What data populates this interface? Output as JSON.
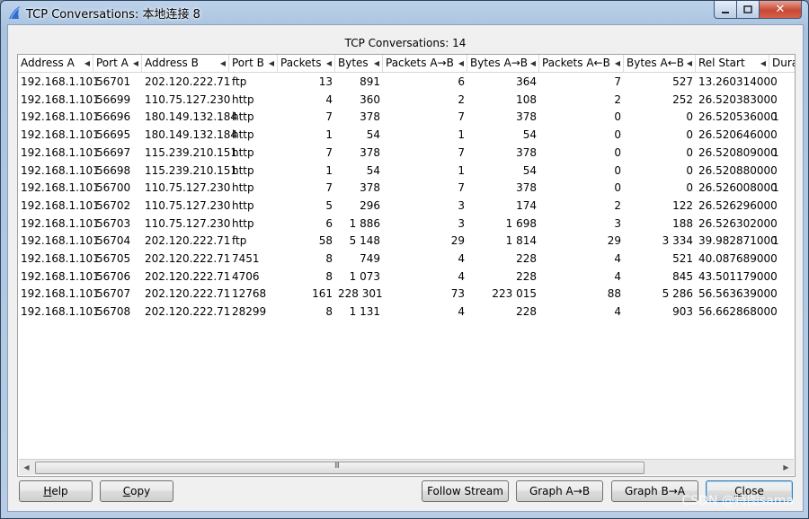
{
  "window": {
    "title": "TCP Conversations: 本地连接 8",
    "minimize_icon": "minimize-icon",
    "maximize_icon": "maximize-icon",
    "close_symbol": "✕"
  },
  "table": {
    "caption": "TCP Conversations: 14",
    "columns": [
      "Address A",
      "Port A",
      "Address B",
      "Port B",
      "Packets",
      "Bytes",
      "Packets A→B",
      "Bytes A→B",
      "Packets A←B",
      "Bytes A←B",
      "Rel Start",
      "Dura"
    ],
    "rows": [
      [
        "192.168.1.101",
        "56701",
        "202.120.222.71",
        "ftp",
        "13",
        "891",
        "6",
        "364",
        "7",
        "527",
        "13.260314000",
        ""
      ],
      [
        "192.168.1.101",
        "56699",
        "110.75.127.230",
        "http",
        "4",
        "360",
        "2",
        "108",
        "2",
        "252",
        "26.520383000",
        ""
      ],
      [
        "192.168.1.101",
        "56696",
        "180.149.132.184",
        "http",
        "7",
        "378",
        "7",
        "378",
        "0",
        "0",
        "26.520536000",
        "1"
      ],
      [
        "192.168.1.101",
        "56695",
        "180.149.132.184",
        "http",
        "1",
        "54",
        "1",
        "54",
        "0",
        "0",
        "26.520646000",
        ""
      ],
      [
        "192.168.1.101",
        "56697",
        "115.239.210.151",
        "http",
        "7",
        "378",
        "7",
        "378",
        "0",
        "0",
        "26.520809000",
        "1"
      ],
      [
        "192.168.1.101",
        "56698",
        "115.239.210.151",
        "http",
        "1",
        "54",
        "1",
        "54",
        "0",
        "0",
        "26.520880000",
        ""
      ],
      [
        "192.168.1.101",
        "56700",
        "110.75.127.230",
        "http",
        "7",
        "378",
        "7",
        "378",
        "0",
        "0",
        "26.526008000",
        "1"
      ],
      [
        "192.168.1.101",
        "56702",
        "110.75.127.230",
        "http",
        "5",
        "296",
        "3",
        "174",
        "2",
        "122",
        "26.526296000",
        ""
      ],
      [
        "192.168.1.101",
        "56703",
        "110.75.127.230",
        "http",
        "6",
        "1 886",
        "3",
        "1 698",
        "3",
        "188",
        "26.526302000",
        ""
      ],
      [
        "192.168.1.101",
        "56704",
        "202.120.222.71",
        "ftp",
        "58",
        "5 148",
        "29",
        "1 814",
        "29",
        "3 334",
        "39.982871000",
        "1"
      ],
      [
        "192.168.1.101",
        "56705",
        "202.120.222.71",
        "7451",
        "8",
        "749",
        "4",
        "228",
        "4",
        "521",
        "40.087689000",
        ""
      ],
      [
        "192.168.1.101",
        "56706",
        "202.120.222.71",
        "4706",
        "8",
        "1 073",
        "4",
        "228",
        "4",
        "845",
        "43.501179000",
        ""
      ],
      [
        "192.168.1.101",
        "56707",
        "202.120.222.71",
        "12768",
        "161",
        "228 301",
        "73",
        "223 015",
        "88",
        "5 286",
        "56.563639000",
        ""
      ],
      [
        "192.168.1.101",
        "56708",
        "202.120.222.71",
        "28299",
        "8",
        "1 131",
        "4",
        "228",
        "4",
        "903",
        "56.662868000",
        ""
      ]
    ]
  },
  "scrollbar": {
    "left_arrow": "◀",
    "right_arrow": "▶",
    "grip": "III"
  },
  "buttons": {
    "help": {
      "u": "H",
      "rest": "elp"
    },
    "copy": {
      "u": "C",
      "rest": "opy"
    },
    "follow_stream": "Follow Stream",
    "graph_ab": "Graph A→B",
    "graph_ba": "Graph B→A",
    "close": {
      "u": "C",
      "rest": "lose"
    }
  },
  "watermark": "CSDN @特图sama"
}
